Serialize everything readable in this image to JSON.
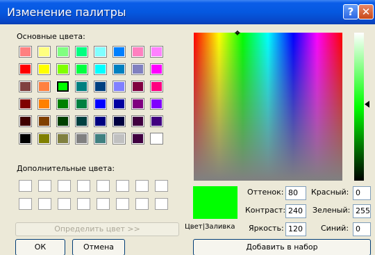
{
  "window": {
    "title": "Изменение палитры",
    "help_button": "?",
    "close_button": "✕"
  },
  "basic": {
    "label": "Основные цвета:",
    "colors": [
      [
        "#FF8080",
        "#FFFF80",
        "#80FF80",
        "#00FF80",
        "#80FFFF",
        "#0080FF",
        "#FF80C0",
        "#FF80FF"
      ],
      [
        "#FF0000",
        "#FFFF00",
        "#80FF00",
        "#00FF40",
        "#00FFFF",
        "#0080C0",
        "#8080C0",
        "#FF00FF"
      ],
      [
        "#804040",
        "#FF8040",
        "#00FF00",
        "#008080",
        "#004080",
        "#8080FF",
        "#800040",
        "#FF0080"
      ],
      [
        "#800000",
        "#FF8000",
        "#008000",
        "#008040",
        "#0000FF",
        "#0000A0",
        "#800080",
        "#8000FF"
      ],
      [
        "#400000",
        "#804000",
        "#004000",
        "#004040",
        "#000080",
        "#000040",
        "#400040",
        "#400080"
      ],
      [
        "#000000",
        "#808000",
        "#808040",
        "#808080",
        "#408080",
        "#C0C0C0",
        "#400040",
        "#FFFFFF"
      ]
    ],
    "selected": {
      "row": 2,
      "col": 2
    }
  },
  "custom": {
    "label": "Дополнительные цвета:",
    "rows": 2,
    "cols": 8
  },
  "buttons": {
    "define_custom": "Определить цвет >>",
    "ok": "ОК",
    "cancel": "Отмена",
    "add": "Добавить в набор"
  },
  "preview": {
    "label": "Цвет|Заливка",
    "color": "#00FF00"
  },
  "fields": {
    "hue_label": "Оттенок:",
    "hue": "80",
    "sat_label": "Контраст:",
    "sat": "240",
    "lum_label": "Яркость:",
    "lum": "120",
    "red_label": "Красный:",
    "red": "0",
    "green_label": "Зеленый:",
    "green": "255",
    "blue_label": "Синий:",
    "blue": "0"
  },
  "icons": {
    "crosshair": "crosshair-icon",
    "luminance_pointer": "arrow-left-icon"
  }
}
